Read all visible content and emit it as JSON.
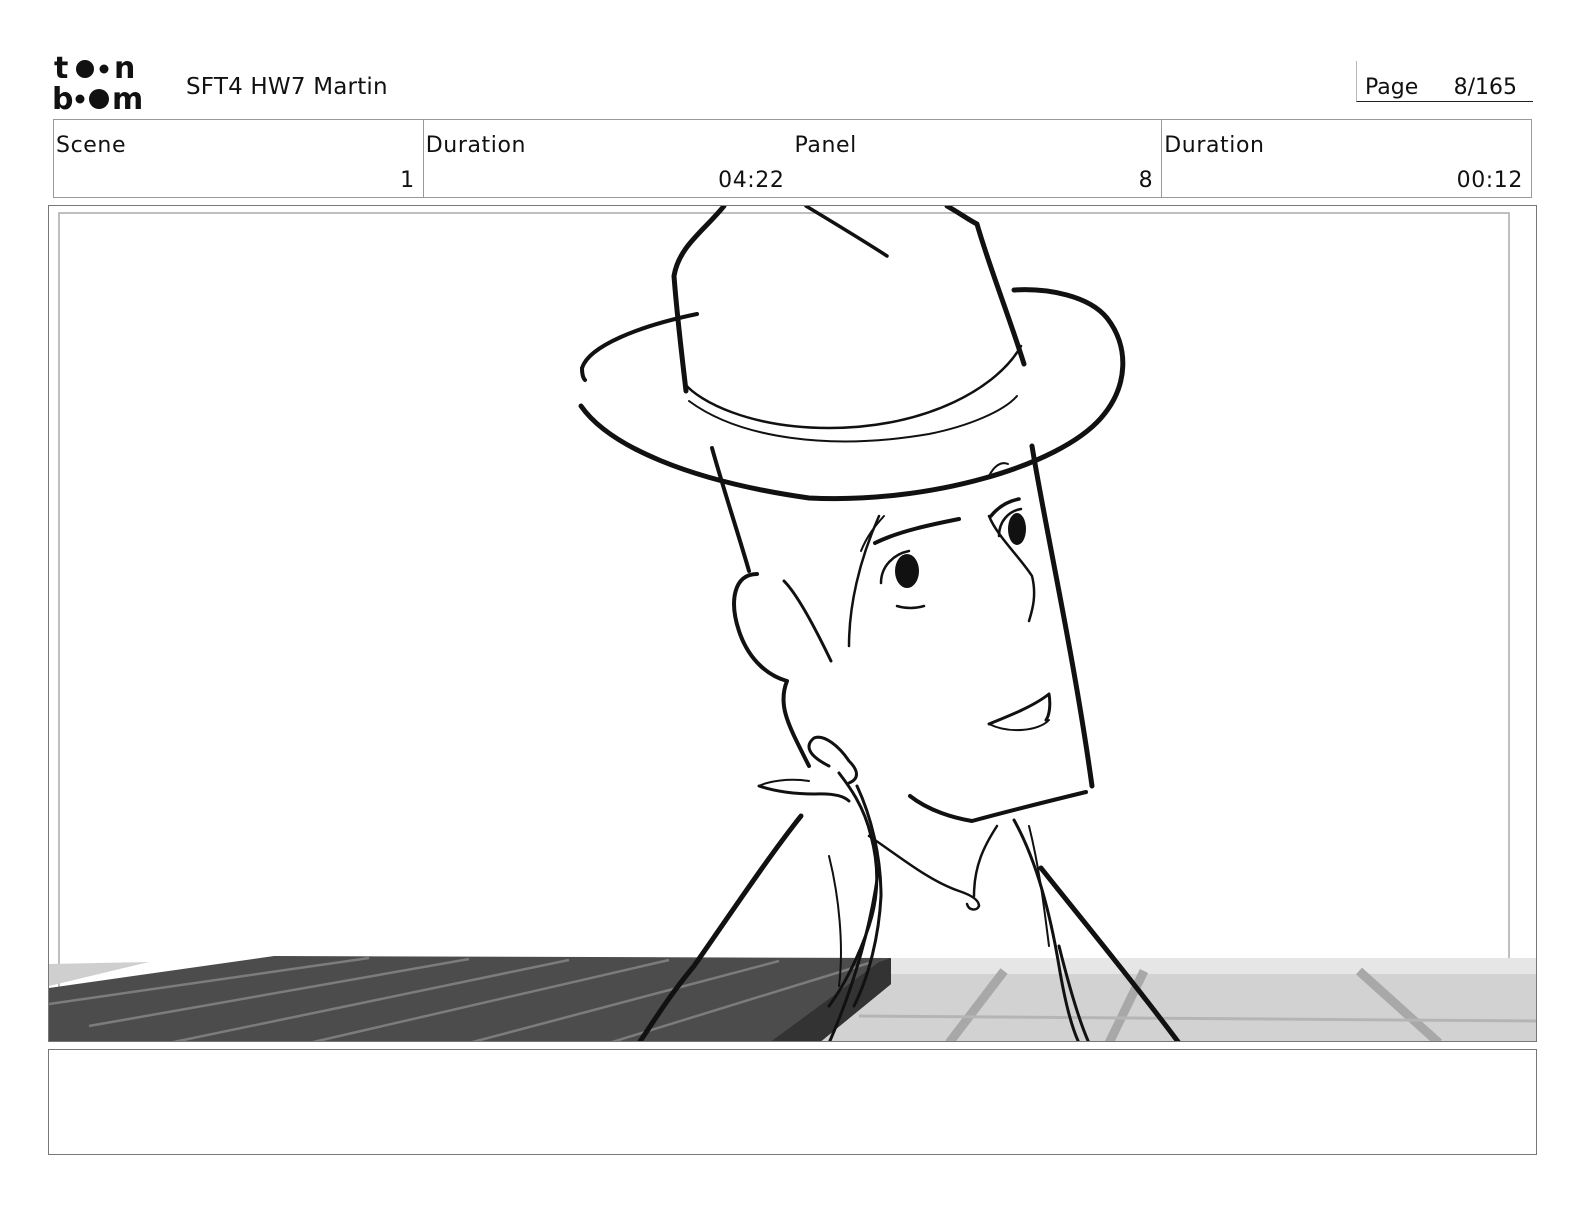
{
  "header": {
    "logo_text": "toon boom",
    "project_title": "SFT4 HW7 Martin",
    "page_label": "Page",
    "page_value": "8/165"
  },
  "info": {
    "scene_label": "Scene",
    "scene_value": "1",
    "scene_duration_label": "Duration",
    "scene_duration_value": "04:22",
    "panel_label": "Panel",
    "panel_value": "8",
    "panel_duration_label": "Duration",
    "panel_duration_value": "00:12"
  },
  "panel": {
    "image_icon": "storyboard-sketch-cowboy",
    "colors": {
      "line": "#111111",
      "dark_planks": "#4a4a4a",
      "light_floor": "#cfcfcf"
    }
  },
  "caption": {
    "text": ""
  }
}
